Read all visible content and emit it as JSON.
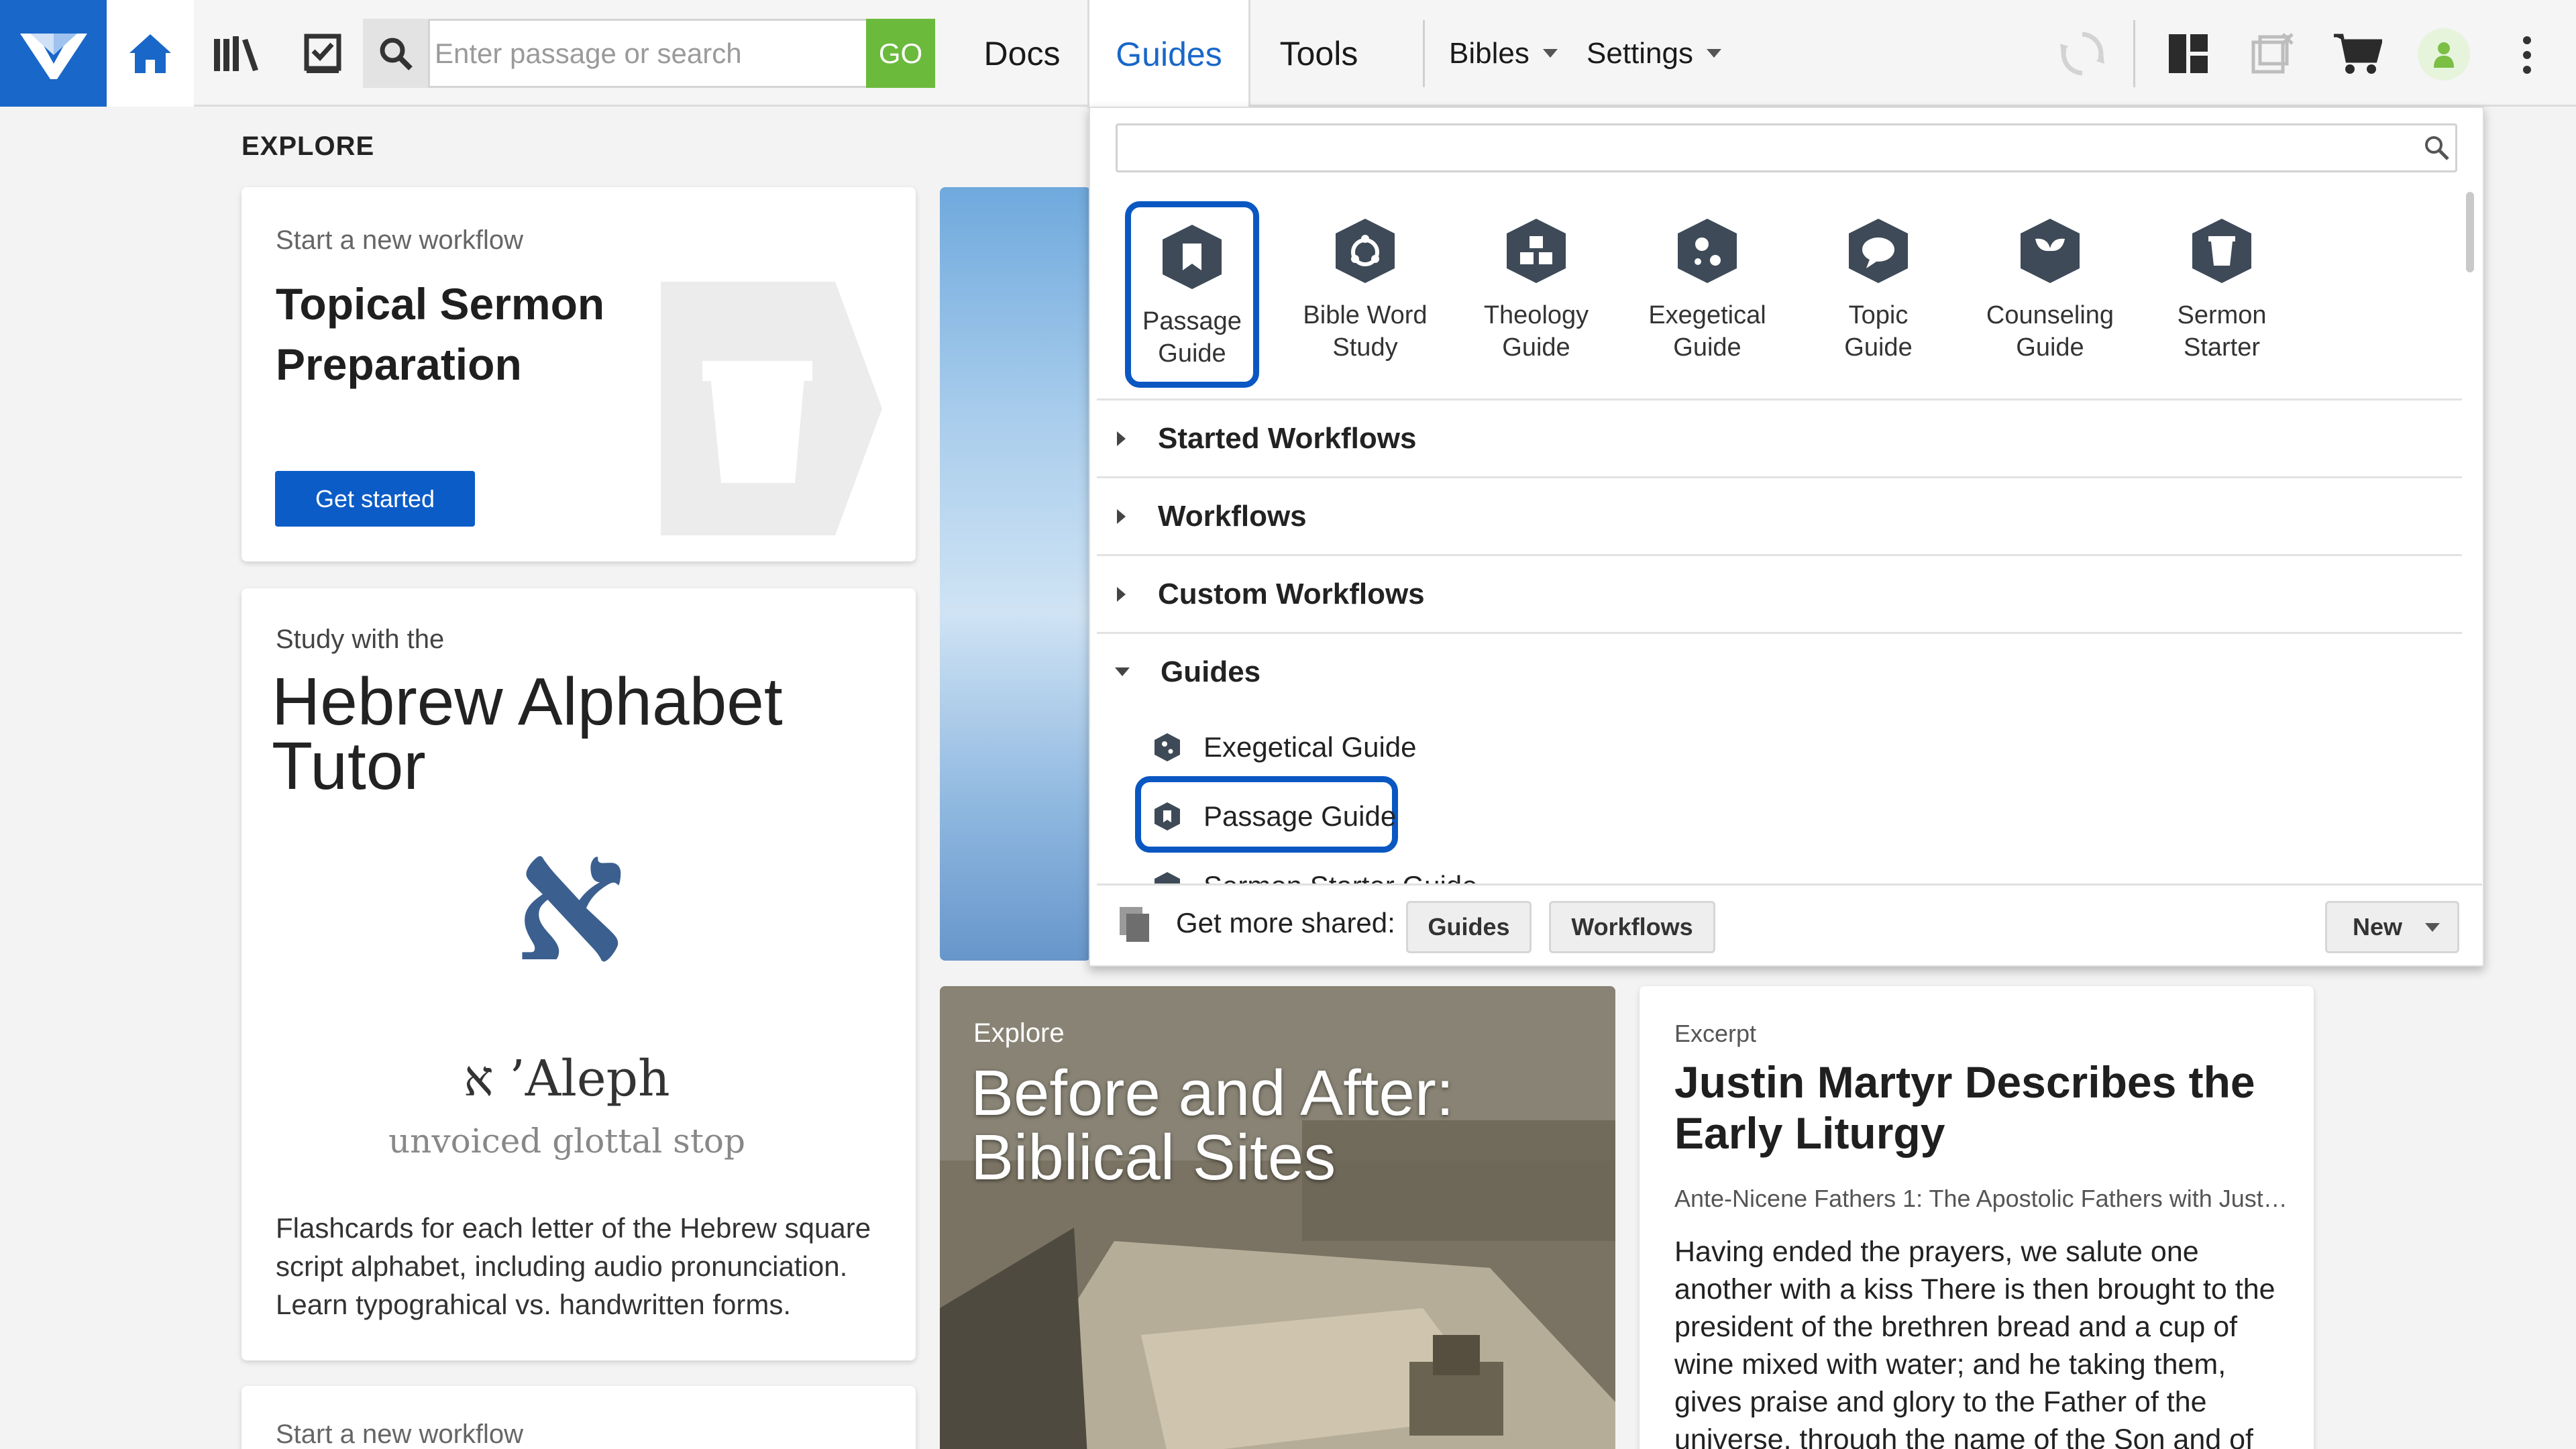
{
  "topbar": {
    "search_placeholder": "Enter passage or search",
    "go_label": "GO",
    "tabs": [
      "Docs",
      "Guides",
      "Tools"
    ],
    "menus": [
      "Bibles",
      "Settings"
    ]
  },
  "explore": {
    "heading": "EXPLORE",
    "workflow_card": {
      "kicker": "Start a new workflow",
      "title_line1": "Topical Sermon",
      "title_line2": "Preparation",
      "button": "Get started"
    },
    "hebrew_card": {
      "kicker": "Study with the",
      "title_line1": "Hebrew Alphabet",
      "title_line2": "Tutor",
      "glyph": "א",
      "letter_name": "א ’Aleph",
      "letter_desc": "unvoiced glottal stop",
      "desc_line1": "Flashcards for each letter of the Hebrew square",
      "desc_line2": "script alphabet, including audio pronunciation.",
      "desc_line3": "Learn typograhical vs. handwritten forms."
    },
    "bottom_card_kicker": "Start a new workflow",
    "sites_card": {
      "kicker": "Explore",
      "title_line1": "Before and After:",
      "title_line2": "Biblical Sites"
    },
    "excerpt_card": {
      "kicker": "Excerpt",
      "title_line1": "Justin Martyr Describes the",
      "title_line2": "Early Liturgy",
      "source": "Ante-Nicene Fathers 1: The Apostolic Fathers with Just…",
      "lines": [
        "Having ended the prayers, we salute one",
        "another with a kiss There is then brought to the",
        "president of the brethren bread and a cup of",
        "wine mixed with water; and he taking them,",
        "gives praise and glory to the Father of the",
        "universe, through the name of the Son and of"
      ]
    }
  },
  "guides_panel": {
    "tiles": [
      {
        "line1": "Passage",
        "line2": "Guide"
      },
      {
        "line1": "Bible Word",
        "line2": "Study"
      },
      {
        "line1": "Theology",
        "line2": "Guide"
      },
      {
        "line1": "Exegetical",
        "line2": "Guide"
      },
      {
        "line1": "Topic Guide",
        "line2": ""
      },
      {
        "line1": "Counseling",
        "line2": "Guide"
      },
      {
        "line1": "Sermon",
        "line2": "Starter"
      }
    ],
    "sections": [
      "Started Workflows",
      "Workflows",
      "Custom Workflows",
      "Guides"
    ],
    "guide_items": [
      "Exegetical Guide",
      "Passage Guide",
      "Sermon Starter Guide"
    ],
    "footer": {
      "label": "Get more shared:",
      "guides_btn": "Guides",
      "workflows_btn": "Workflows",
      "new_btn": "New"
    }
  },
  "colors": {
    "brand": "#1967c8",
    "go": "#6cba3c",
    "selected_ring": "#0a57c2",
    "avatar": "#7bbf45"
  },
  "icons": [
    "logos-logo",
    "home-icon",
    "library-icon",
    "checklist-icon",
    "search-icon",
    "sync-icon",
    "layouts-icon",
    "close-panels-icon",
    "cart-icon",
    "user-icon",
    "more-icon"
  ]
}
